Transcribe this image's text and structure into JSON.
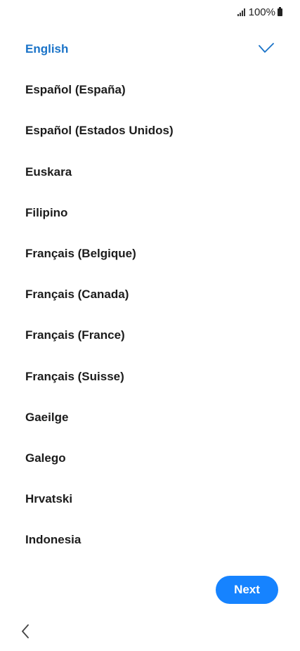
{
  "status_bar": {
    "battery_text": "100%",
    "icons": [
      "signal-icon",
      "battery-icon"
    ]
  },
  "languages": [
    {
      "label": "English",
      "selected": true
    },
    {
      "label": "Español (España)",
      "selected": false
    },
    {
      "label": "Español (Estados Unidos)",
      "selected": false
    },
    {
      "label": "Euskara",
      "selected": false
    },
    {
      "label": "Filipino",
      "selected": false
    },
    {
      "label": "Français (Belgique)",
      "selected": false
    },
    {
      "label": "Français (Canada)",
      "selected": false
    },
    {
      "label": "Français (France)",
      "selected": false
    },
    {
      "label": "Français (Suisse)",
      "selected": false
    },
    {
      "label": "Gaeilge",
      "selected": false
    },
    {
      "label": "Galego",
      "selected": false
    },
    {
      "label": "Hrvatski",
      "selected": false
    },
    {
      "label": "Indonesia",
      "selected": false
    }
  ],
  "colors": {
    "selected_text": "#1a73c8",
    "next_button_bg": "#1683ff",
    "next_button_text": "#ffffff"
  },
  "footer": {
    "next_label": "Next",
    "back_icon": "chevron-left-icon"
  }
}
